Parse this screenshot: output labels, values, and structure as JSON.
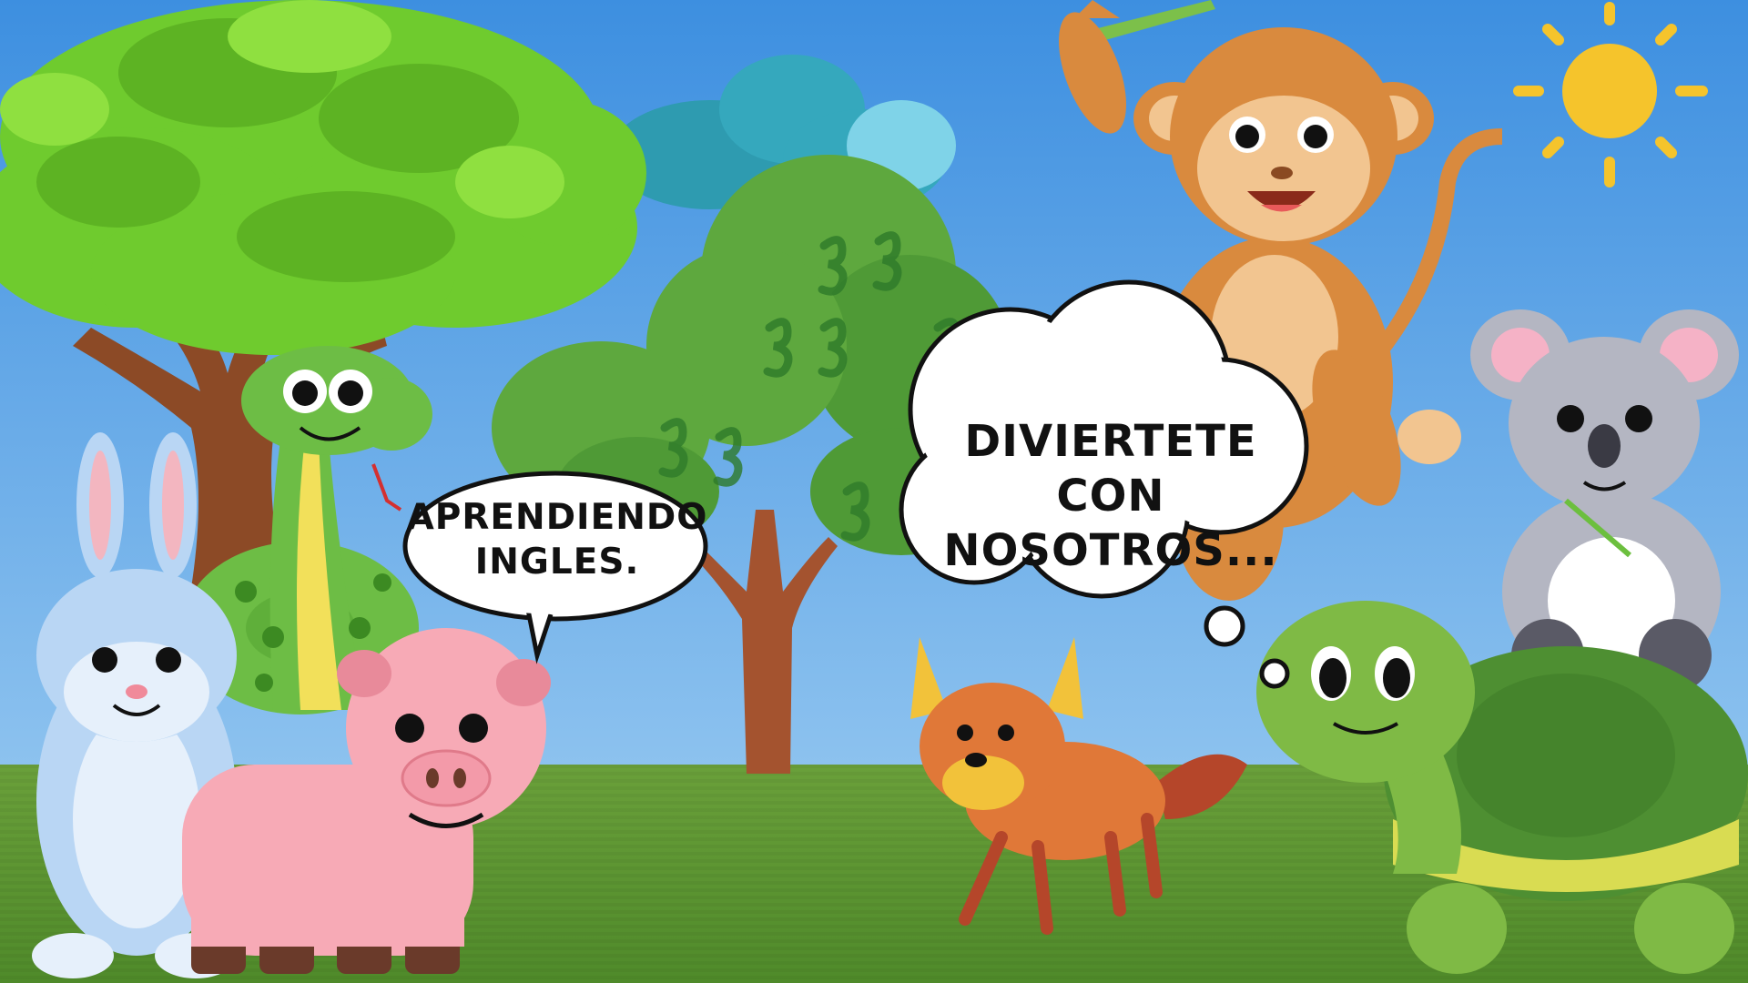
{
  "scene": {
    "bubbles": [
      {
        "id": "speech-bubble-pig",
        "lines": [
          "APRENDIENDO",
          "INGLES."
        ]
      },
      {
        "id": "thought-bubble-fox",
        "lines": [
          "DIVIERTETE CON",
          "NOSOTROS..."
        ]
      }
    ],
    "animals": [
      "rabbit",
      "snake",
      "pig",
      "fox",
      "monkey",
      "koala",
      "turtle"
    ],
    "colors": {
      "sky_top": "#3d8fe0",
      "sky_bottom": "#8ec3ef",
      "grass": "#5e9432",
      "sun": "#f5c42c",
      "pig": "#f7aab6",
      "monkey": "#d98a3e",
      "turtle": "#7fba45",
      "fox": "#e07838",
      "rabbit": "#b9d6f4",
      "koala": "#b4b6c2",
      "snake": "#5fb83a"
    }
  }
}
